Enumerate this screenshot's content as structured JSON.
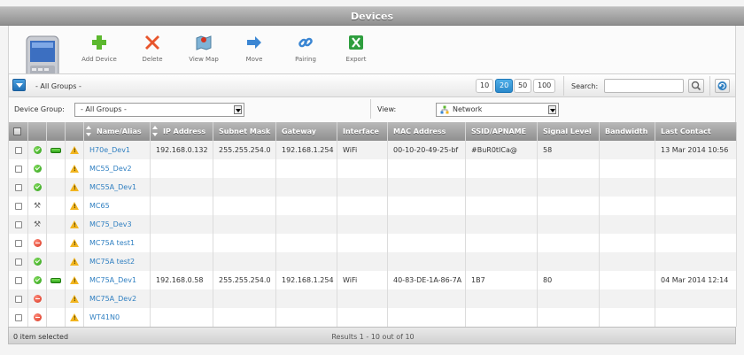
{
  "window": {
    "title": "Devices"
  },
  "toolbar": {
    "items": [
      {
        "label": "Add Device",
        "icon": "add-icon"
      },
      {
        "label": "Delete",
        "icon": "delete-icon"
      },
      {
        "label": "View Map",
        "icon": "map-icon"
      },
      {
        "label": "Move",
        "icon": "move-arrow-icon"
      },
      {
        "label": "Pairing",
        "icon": "link-icon"
      },
      {
        "label": "Export",
        "icon": "excel-icon"
      }
    ]
  },
  "subbar": {
    "group_label": "- All Groups -",
    "page_sizes": [
      "10",
      "20",
      "50",
      "100"
    ],
    "active_page_size": "20",
    "search_label": "Search:",
    "search_value": ""
  },
  "filters": {
    "device_group_label": "Device Group:",
    "device_group_value": "- All Groups -",
    "view_label": "View:",
    "view_value": "Network"
  },
  "table": {
    "columns": [
      "",
      "",
      "",
      "",
      "Name/Alias",
      "IP Address",
      "Subnet Mask",
      "Gateway",
      "Interface",
      "MAC Address",
      "SSID/APNAME",
      "Signal Level",
      "Bandwidth",
      "Last Contact"
    ],
    "rows": [
      {
        "status": "online",
        "battery": true,
        "name": "H70e_Dev1",
        "ip": "192.168.0.132",
        "subnet": "255.255.254.0",
        "gateway": "192.168.1.254",
        "iface": "WiFi",
        "mac": "00-10-20-49-25-bf",
        "ssid": "#BuR0tICa@",
        "signal": "58",
        "bandwidth": "",
        "last": "13 Mar 2014 10:56"
      },
      {
        "status": "online",
        "battery": false,
        "name": "MC55_Dev2",
        "ip": "",
        "subnet": "",
        "gateway": "",
        "iface": "",
        "mac": "",
        "ssid": "",
        "signal": "",
        "bandwidth": "",
        "last": ""
      },
      {
        "status": "online",
        "battery": false,
        "name": "MC55A_Dev1",
        "ip": "",
        "subnet": "",
        "gateway": "",
        "iface": "",
        "mac": "",
        "ssid": "",
        "signal": "",
        "bandwidth": "",
        "last": ""
      },
      {
        "status": "tools",
        "battery": false,
        "name": "MC65",
        "ip": "",
        "subnet": "",
        "gateway": "",
        "iface": "",
        "mac": "",
        "ssid": "",
        "signal": "",
        "bandwidth": "",
        "last": ""
      },
      {
        "status": "tools",
        "battery": false,
        "name": "MC75_Dev3",
        "ip": "",
        "subnet": "",
        "gateway": "",
        "iface": "",
        "mac": "",
        "ssid": "",
        "signal": "",
        "bandwidth": "",
        "last": ""
      },
      {
        "status": "offline",
        "battery": false,
        "name": "MC75A test1",
        "ip": "",
        "subnet": "",
        "gateway": "",
        "iface": "",
        "mac": "",
        "ssid": "",
        "signal": "",
        "bandwidth": "",
        "last": ""
      },
      {
        "status": "online",
        "battery": false,
        "name": "MC75A test2",
        "ip": "",
        "subnet": "",
        "gateway": "",
        "iface": "",
        "mac": "",
        "ssid": "",
        "signal": "",
        "bandwidth": "",
        "last": ""
      },
      {
        "status": "online",
        "battery": true,
        "name": "MC75A_Dev1",
        "ip": "192.168.0.58",
        "subnet": "255.255.254.0",
        "gateway": "192.168.1.254",
        "iface": "WiFi",
        "mac": "40-83-DE-1A-86-7A",
        "ssid": "1B7",
        "signal": "80",
        "bandwidth": "",
        "last": "04 Mar 2014 12:14"
      },
      {
        "status": "offline",
        "battery": false,
        "name": "MC75A_Dev2",
        "ip": "",
        "subnet": "",
        "gateway": "",
        "iface": "",
        "mac": "",
        "ssid": "",
        "signal": "",
        "bandwidth": "",
        "last": ""
      },
      {
        "status": "offline",
        "battery": false,
        "name": "WT41N0",
        "ip": "",
        "subnet": "",
        "gateway": "",
        "iface": "",
        "mac": "",
        "ssid": "",
        "signal": "",
        "bandwidth": "",
        "last": ""
      }
    ]
  },
  "footer": {
    "selected": "0 item selected",
    "results": "Results 1 - 10 out of 10"
  },
  "colors": {
    "accent": "#2f7fc1",
    "header": "#9e9e9e",
    "add": "#5cb82e",
    "delete": "#e8552c",
    "excel": "#2e9e3e"
  }
}
